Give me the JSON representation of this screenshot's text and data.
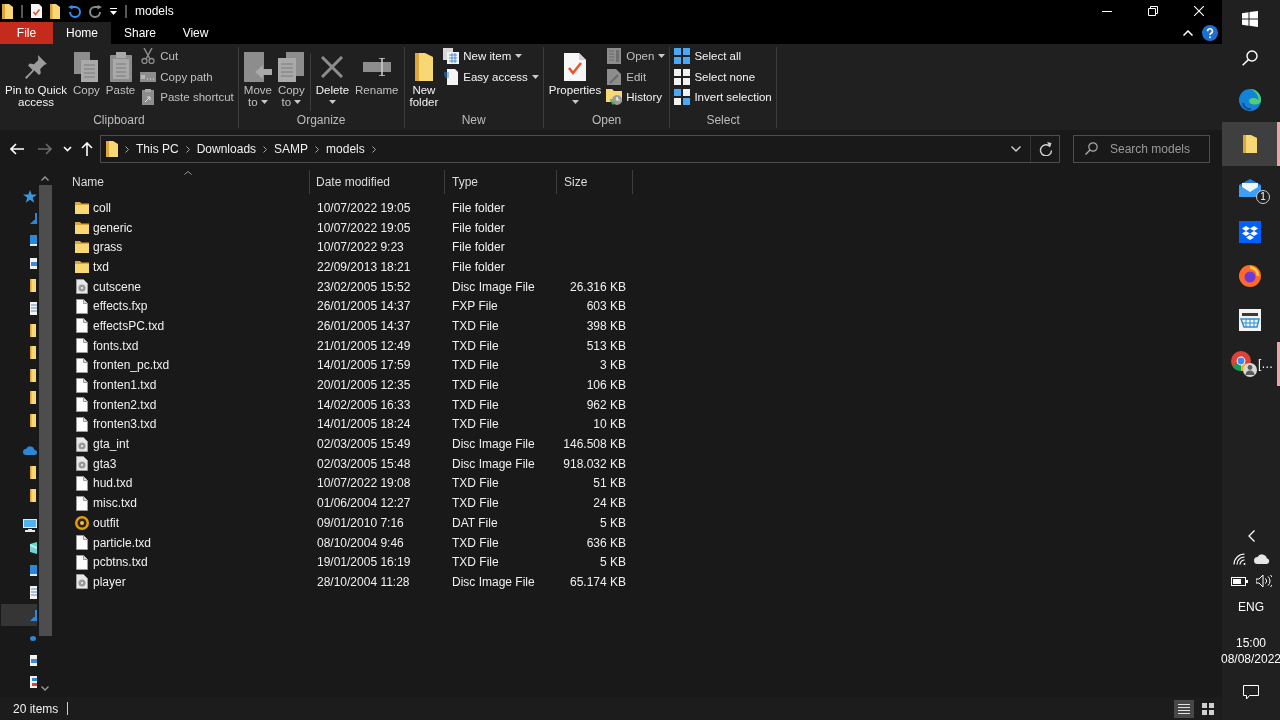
{
  "title_bar": {
    "title": "models"
  },
  "ribbon": {
    "tabs": [
      {
        "label": "File",
        "kind": "file",
        "selected": false
      },
      {
        "label": "Home",
        "kind": "tab",
        "selected": true
      },
      {
        "label": "Share",
        "kind": "tab",
        "selected": false
      },
      {
        "label": "View",
        "kind": "tab",
        "selected": false
      }
    ],
    "groups": [
      {
        "label": "Clipboard",
        "buttons": [
          {
            "label": "Pin to Quick access",
            "kind": "large",
            "disabled": false,
            "menu": false
          },
          {
            "label": "Copy",
            "kind": "large",
            "disabled": true,
            "menu": false
          },
          {
            "label": "Paste",
            "kind": "large",
            "disabled": true,
            "menu": false
          },
          {
            "label": "Cut",
            "kind": "small",
            "disabled": true,
            "menu": false
          },
          {
            "label": "Copy path",
            "kind": "small",
            "disabled": true,
            "menu": false
          },
          {
            "label": "Paste shortcut",
            "kind": "small",
            "disabled": true,
            "menu": false
          }
        ]
      },
      {
        "label": "Organize",
        "buttons": [
          {
            "label": "Move to",
            "kind": "large",
            "disabled": true,
            "menu": true
          },
          {
            "label": "Copy to",
            "kind": "large",
            "disabled": true,
            "menu": true
          },
          {
            "label": "Delete",
            "kind": "large",
            "disabled": false,
            "menu": true
          },
          {
            "label": "Rename",
            "kind": "large",
            "disabled": true,
            "menu": false
          }
        ]
      },
      {
        "label": "New",
        "buttons": [
          {
            "label": "New folder",
            "kind": "large",
            "disabled": false,
            "menu": false
          },
          {
            "label": "New item",
            "kind": "small",
            "disabled": false,
            "menu": true
          },
          {
            "label": "Easy access",
            "kind": "small",
            "disabled": false,
            "menu": true
          }
        ]
      },
      {
        "label": "Open",
        "buttons": [
          {
            "label": "Properties",
            "kind": "large",
            "disabled": false,
            "menu": true
          },
          {
            "label": "Open",
            "kind": "small",
            "disabled": true,
            "menu": true
          },
          {
            "label": "Edit",
            "kind": "small",
            "disabled": true,
            "menu": false
          },
          {
            "label": "History",
            "kind": "small",
            "disabled": false,
            "menu": false
          }
        ]
      },
      {
        "label": "Select",
        "buttons": [
          {
            "label": "Select all",
            "kind": "small",
            "disabled": false,
            "menu": false
          },
          {
            "label": "Select none",
            "kind": "small",
            "disabled": false,
            "menu": false
          },
          {
            "label": "Invert selection",
            "kind": "small",
            "disabled": false,
            "menu": false
          }
        ]
      }
    ]
  },
  "address_bar": {
    "nav_buttons": [
      {
        "kind": "back",
        "disabled": false
      },
      {
        "kind": "forward",
        "disabled": true
      },
      {
        "kind": "recent",
        "disabled": false
      },
      {
        "kind": "up",
        "disabled": false
      }
    ],
    "crumbs": [
      "This PC",
      "Downloads",
      "SAMP",
      "models"
    ]
  },
  "search": {
    "placeholder": "Search models"
  },
  "nav_pane": {
    "items": [
      {
        "kind": "quick-access",
        "selected": false,
        "children": [
          {
            "kind": "downloads",
            "selected": false
          },
          {
            "kind": "desktop",
            "selected": false
          },
          {
            "kind": "pictures",
            "selected": false
          },
          {
            "kind": "folder",
            "selected": false
          },
          {
            "kind": "documents",
            "selected": false
          },
          {
            "kind": "folder",
            "selected": false
          },
          {
            "kind": "folder",
            "selected": false
          },
          {
            "kind": "folder",
            "selected": false
          },
          {
            "kind": "folder",
            "selected": false
          },
          {
            "kind": "folder",
            "selected": false
          }
        ]
      },
      {
        "kind": "onedrive",
        "selected": false,
        "children": [
          {
            "kind": "folder",
            "selected": false
          },
          {
            "kind": "folder",
            "selected": false
          }
        ]
      },
      {
        "kind": "computer",
        "selected": false,
        "children": [
          {
            "kind": "objects",
            "selected": false
          },
          {
            "kind": "desktop",
            "selected": false
          },
          {
            "kind": "documents",
            "selected": false
          },
          {
            "kind": "downloads",
            "selected": true
          },
          {
            "kind": "music",
            "selected": false
          },
          {
            "kind": "pictures",
            "selected": false
          },
          {
            "kind": "videos",
            "selected": false
          }
        ]
      }
    ]
  },
  "file_list": {
    "columns": [
      {
        "label": "Name",
        "sorted": true
      },
      {
        "label": "Date modified",
        "sorted": false
      },
      {
        "label": "Type",
        "sorted": false
      },
      {
        "label": "Size",
        "sorted": false
      }
    ],
    "rows": [
      {
        "kind": "folder",
        "name": "coll",
        "date": "10/07/2022 19:05",
        "type": "File folder"
      },
      {
        "kind": "folder",
        "name": "generic",
        "date": "10/07/2022 19:05",
        "type": "File folder"
      },
      {
        "kind": "folder",
        "name": "grass",
        "date": "10/07/2022 9:23",
        "type": "File folder"
      },
      {
        "kind": "folder",
        "name": "txd",
        "date": "22/09/2013 18:21",
        "type": "File folder"
      },
      {
        "kind": "disc",
        "name": "cutscene",
        "date": "23/02/2005 15:52",
        "type": "Disc Image File",
        "size": "26.316 KB"
      },
      {
        "kind": "file",
        "name": "effects.fxp",
        "date": "26/01/2005 14:37",
        "type": "FXP File",
        "size": "603 KB"
      },
      {
        "kind": "file",
        "name": "effectsPC.txd",
        "date": "26/01/2005 14:37",
        "type": "TXD File",
        "size": "398 KB"
      },
      {
        "kind": "file",
        "name": "fonts.txd",
        "date": "21/01/2005 12:49",
        "type": "TXD File",
        "size": "513 KB"
      },
      {
        "kind": "file",
        "name": "fronten_pc.txd",
        "date": "14/01/2005 17:59",
        "type": "TXD File",
        "size": "3 KB"
      },
      {
        "kind": "file",
        "name": "fronten1.txd",
        "date": "20/01/2005 12:35",
        "type": "TXD File",
        "size": "106 KB"
      },
      {
        "kind": "file",
        "name": "fronten2.txd",
        "date": "14/02/2005 16:33",
        "type": "TXD File",
        "size": "962 KB"
      },
      {
        "kind": "file",
        "name": "fronten3.txd",
        "date": "14/01/2005 18:24",
        "type": "TXD File",
        "size": "10 KB"
      },
      {
        "kind": "disc",
        "name": "gta_int",
        "date": "02/03/2005 15:49",
        "type": "Disc Image File",
        "size": "146.508 KB"
      },
      {
        "kind": "disc",
        "name": "gta3",
        "date": "02/03/2005 15:48",
        "type": "Disc Image File",
        "size": "918.032 KB"
      },
      {
        "kind": "file",
        "name": "hud.txd",
        "date": "10/07/2022 19:08",
        "type": "TXD File",
        "size": "51 KB"
      },
      {
        "kind": "file",
        "name": "misc.txd",
        "date": "01/06/2004 12:27",
        "type": "TXD File",
        "size": "24 KB"
      },
      {
        "kind": "dat",
        "name": "outfit",
        "date": "09/01/2010 7:16",
        "type": "DAT File",
        "size": "5 KB"
      },
      {
        "kind": "file",
        "name": "particle.txd",
        "date": "08/10/2004 9:46",
        "type": "TXD File",
        "size": "636 KB"
      },
      {
        "kind": "file",
        "name": "pcbtns.txd",
        "date": "19/01/2005 16:19",
        "type": "TXD File",
        "size": "5 KB"
      },
      {
        "kind": "disc",
        "name": "player",
        "date": "28/10/2004 11:28",
        "type": "Disc Image File",
        "size": "65.174 KB"
      }
    ]
  },
  "status_bar": {
    "item_count": "20 items",
    "views": [
      {
        "kind": "details",
        "selected": true
      },
      {
        "kind": "tiles",
        "selected": false
      }
    ]
  },
  "taskbar": {
    "items": [
      {
        "kind": "start",
        "running": false,
        "active": false
      },
      {
        "kind": "search",
        "running": false,
        "active": false
      },
      {
        "kind": "edge",
        "running": false,
        "active": false
      },
      {
        "kind": "explorer",
        "running": true,
        "active": true
      },
      {
        "kind": "mail",
        "running": false,
        "active": false,
        "badge": "1"
      },
      {
        "kind": "dropbox",
        "running": false,
        "active": false
      },
      {
        "kind": "firefox",
        "running": false,
        "active": false
      },
      {
        "kind": "amazon",
        "running": false,
        "active": false
      },
      {
        "kind": "chrome",
        "running": true,
        "active": false,
        "label": "[…"
      }
    ],
    "tray": {
      "language": "ENG",
      "time": "15:00",
      "date": "08/08/2022"
    }
  }
}
